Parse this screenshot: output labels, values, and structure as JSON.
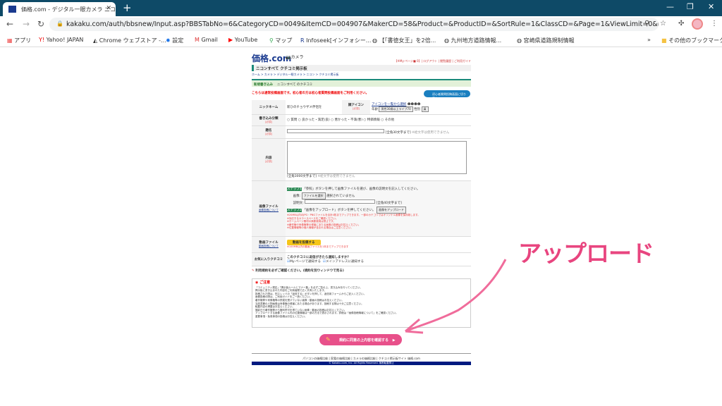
{
  "browser": {
    "tab_title": "価格.com - デジタル一眼カメラ ニコン",
    "url": "kakaku.com/auth/bbsnew/Input.asp?BBSTabNo=6&CategoryCD=0049&ItemCD=004907&MakerCD=58&Product=&ProductID=&SortRule=1&ClassCD=&Page=1&ViewLimit=0&Input=%90V%8B...",
    "bookmarks": [
      "アプリ",
      "Yahoo! JAPAN",
      "Chrome ウェブストア -...",
      "設定",
      "Gmail",
      "YouTube",
      "マップ",
      "Infoseek[インフォシー...",
      "【「書徳女王」を2倍...",
      "九州地方道路情報...",
      "宮崎県道路規制情報",
      "その他のブックマーク"
    ]
  },
  "page": {
    "logo": "価格.com",
    "logo_sub": "カメラ",
    "toplinks": "【※My-ページ■ 0】| ログアウト | 閲覧履歴 | ご利用ガイド",
    "board_title": "ニコンすべて クチコミ掲示板",
    "breadcrumb": "ホーム > カメラ > デジタル一眼カメラ > ニコン > クチコミ掲示板",
    "green_label": "新規書き込み",
    "green_target": "ニコンすべて のクチコミ",
    "notice": "こちらは通常投稿画面です。初心者の方は初心者質問投稿画面をご利用ください。",
    "switch_button": "初心者質問投稿画面に切り替える",
    "nickname_label": "ニックネーム",
    "nickname_value": "新ひのチョウザメ伴侶を",
    "icon_label": "顔アイコン",
    "required": "[必須]",
    "icon_link": "アイコンを一覧から選択",
    "age_label": "年齢",
    "age_value": "男性30歳以上ライブ70",
    "gender_label": "性別",
    "gender_value": "員",
    "category_label": "書き込み分類",
    "categories": [
      "質問",
      "良かった・満足(良)",
      "悪かった・不満(悪)",
      "特価情報",
      "その他"
    ],
    "title_label": "題名",
    "title_hint": "[全角30文字まで]",
    "title_hint2": "※絵文字は使用できません",
    "content_label": "内容",
    "content_hint": "[全角3000文字まで]",
    "content_hint2": "※絵文字は使用できません",
    "image_label": "画像ファイル",
    "image_help": "画像投稿について",
    "step1": "ステップ1",
    "step1_text": "「参照」ボタンを押して画像ファイルを選び、画像の説明文を記入してください。",
    "image_field": "画像:",
    "file_button": "ファイルを選択",
    "file_status": "選択されていません",
    "caption_field": "説明文:",
    "caption_hint": "[全角40文字まで]",
    "step2": "ステップ2",
    "step2_text": "「画像をアップロード」ボタンを押してください。",
    "upload_button": "画像をアップロード",
    "image_notes": [
      "※20MB以内のJPG・PNGファイルを合計4枚までアップできます。一部のカテゴリではオリジナル画像を保存致します。",
      "※対応するカラースペースをご確認ください。",
      "※ホームページ素材の無断使用は禁止です。",
      "※著作権や肖像権等の侵害にあたる画像の投稿はお控えください。",
      "※位置情報等の個人情報が含まれる場合はご注意ください。"
    ],
    "video_label": "動画ファイル",
    "video_help": "動画投稿について",
    "video_button": "動画を投稿する",
    "video_note": "※100MB以内の動画ファイルを1本までアップできます",
    "fav_label": "お気に入りクチコミ",
    "fav_question": "このクチコミに返信がきたら通知しますか？",
    "fav_opt1": "My-ページで通知する",
    "fav_opt2": "メインアドレスに通知する",
    "terms": "利用規約を必ずご確認ください。(規約を別ウィンドウで見る)",
    "notes_title": "ご注意",
    "notes": [
      "「コミュニティ規定」「掲示板ルールとマナー集」を必ずご覧の上、書き込みを行ってください。",
      "掲示板に書き込まれた内容をご利用者間で広く共有いたします。",
      "投稿された際は、別スレッドの「返信する」ボタンを押して、返信用フォームからご記入ください。",
      "画像投稿の際は、ご利用ガイドをご一読ください。",
      "著作権等や肖像権等の許諾を受けていない画像・動画の投稿はお控えください。",
      "当該書籍の人物画像は肖像権の侵害にあたる場合があります。投稿する際は十分ご注意ください。",
      "転載内容の掲載はお控えください。",
      "撮影日や著作権等から権利許可を得ていない画像・動画の投稿はお控えください。",
      "アップロードする画像ファイル内の位置情報は一部の方法で表示されます。詳細は「画像投稿情報について」をご確認ください。",
      "重要事項・免責事項の投稿はお控えください。"
    ],
    "confirm_button": "規約に同意の上内容を確認する",
    "footer_links": "パソコンの価格比較 | 家電の価格比較 | カメラの価格比較 | クチコミ掲示板サイト 価格.com",
    "copyright": "© Kakaku.com, Inc. All Rights Reserved. 無断転載禁止"
  },
  "annotation": "アップロード"
}
